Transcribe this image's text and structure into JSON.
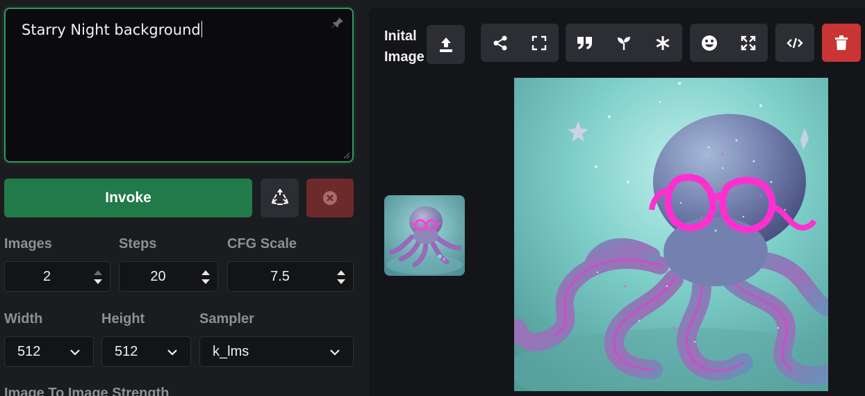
{
  "prompt": {
    "value": "Starry Night background"
  },
  "actions": {
    "invoke_label": "Invoke"
  },
  "params": {
    "images": {
      "label": "Images",
      "value": "2"
    },
    "steps": {
      "label": "Steps",
      "value": "20"
    },
    "cfg_scale": {
      "label": "CFG Scale",
      "value": "7.5"
    },
    "width": {
      "label": "Width",
      "value": "512"
    },
    "height": {
      "label": "Height",
      "value": "512"
    },
    "sampler": {
      "label": "Sampler",
      "value": "k_lms"
    },
    "img2img_strength": {
      "label": "Image To Image Strength"
    }
  },
  "viewer": {
    "initial_image_label_line1": "Inital",
    "initial_image_label_line2": "Image"
  },
  "colors": {
    "accent": "#217a49",
    "prompt_border": "#2f9a5d",
    "cancel": "#6d2a2a",
    "delete": "#c93535"
  },
  "icons": [
    "pin-icon",
    "recycle-icon",
    "cancel-icon",
    "upload-icon",
    "share-icon",
    "fullscreen-icon",
    "quote-icon",
    "seed-icon",
    "asterisk-icon",
    "face-icon",
    "expand-icon",
    "code-icon",
    "trash-icon"
  ]
}
